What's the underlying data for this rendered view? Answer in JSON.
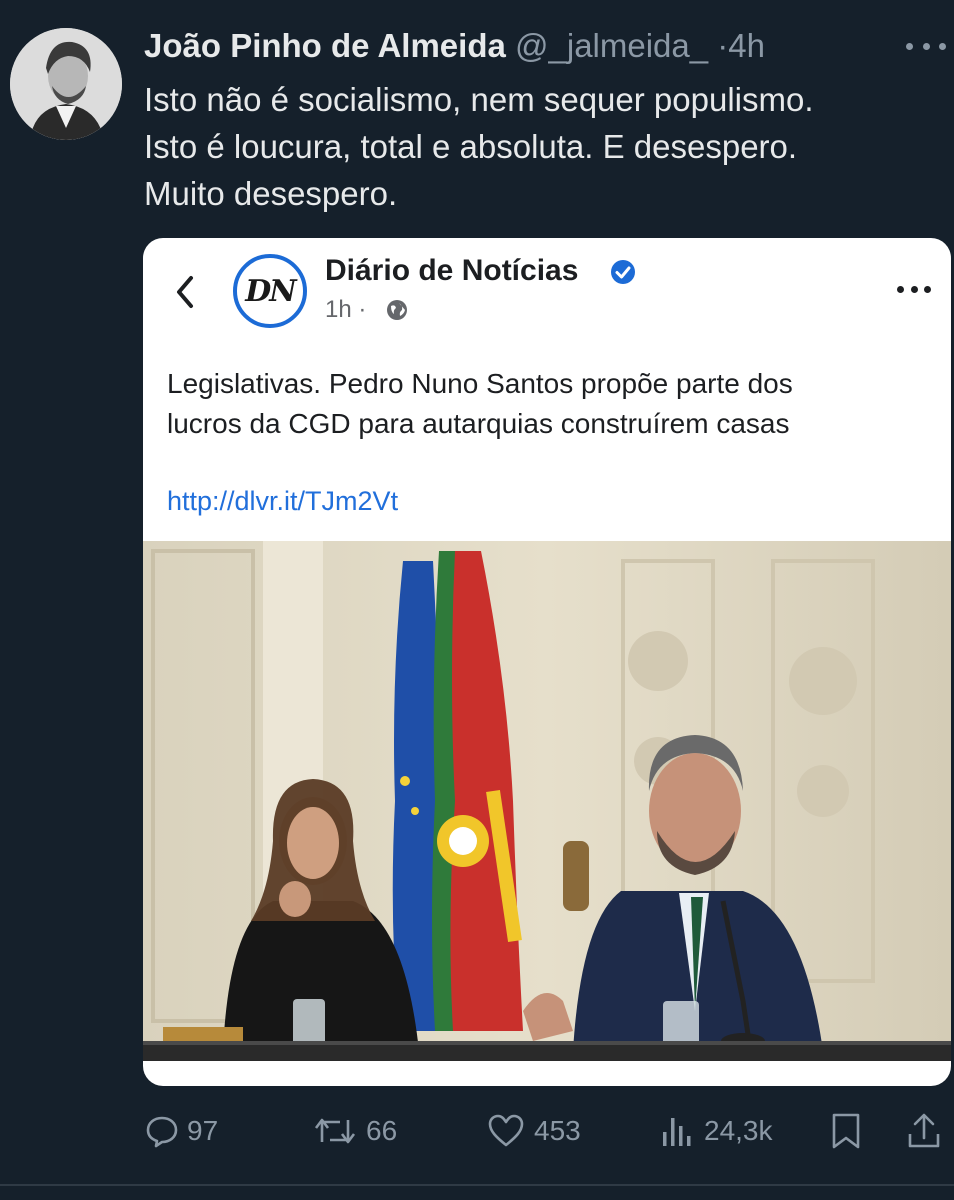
{
  "tweet": {
    "author_name": "João Pinho de Almeida",
    "author_handle": "@_jalmeida_",
    "separator": "·",
    "time": "4h",
    "text_lines": [
      "Isto não é socialismo, nem sequer populismo.",
      "Isto é loucura, total e absoluta. E desespero.",
      "Muito desespero."
    ]
  },
  "embedded_post": {
    "page_name": "Diário de Notícias",
    "logo_text": "DN",
    "meta_time": "1h ·",
    "headline_lines": [
      "Legislativas. Pedro Nuno Santos propõe parte dos",
      "lucros da CGD para autarquias construírem casas"
    ],
    "link": "http://dlvr.it/TJm2Vt"
  },
  "actions": {
    "replies": "97",
    "retweets": "66",
    "likes": "453",
    "views": "24,3k"
  },
  "colors": {
    "background": "#15202b",
    "text": "#e7e9ea",
    "muted": "#8b98a5",
    "link": "#216fdb",
    "verified": "#1c6bd6"
  },
  "icons": [
    "back-icon",
    "verified-icon",
    "globe-icon",
    "more-icon",
    "reply-icon",
    "retweet-icon",
    "like-icon",
    "views-icon",
    "bookmark-icon",
    "share-icon"
  ]
}
